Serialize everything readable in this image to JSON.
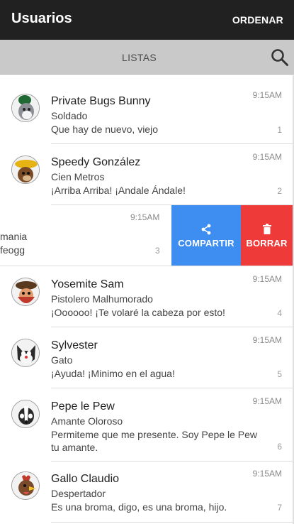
{
  "appbar": {
    "title": "Usuarios",
    "action": "ORDENAR"
  },
  "tabs": {
    "active": "LISTAS"
  },
  "items": [
    {
      "name": "Private Bugs Bunny",
      "subtitle": "Soldado",
      "message": "Que hay de nuevo, viejo",
      "time": "9:15AM",
      "index": "1",
      "avatar": "bugs-bunny-avatar"
    },
    {
      "name": "Speedy González",
      "subtitle": "Cien Metros",
      "message": "¡Arriba Arriba! ¡Andale Ándale!",
      "time": "9:15AM",
      "index": "2",
      "avatar": "speedy-gonzalez-avatar"
    },
    {
      "line1": "mania",
      "line2": "feogg",
      "time": "9:15AM",
      "index": "3"
    },
    {
      "name": "Yosemite Sam",
      "subtitle": "Pistolero Malhumorado",
      "message": "¡Oooooo! ¡Te volaré la cabeza por esto!",
      "time": "9:15AM",
      "index": "4",
      "avatar": "yosemite-sam-avatar"
    },
    {
      "name": "Sylvester",
      "subtitle": "Gato",
      "message": "¡Ayuda! ¡Minimo en el agua!",
      "time": "9:15AM",
      "index": "5",
      "avatar": "sylvester-avatar"
    },
    {
      "name": "Pepe le Pew",
      "subtitle": "Amante Oloroso",
      "message": "Permiteme que me presente. Soy Pepe le Pew tu amante.",
      "time": "9:15AM",
      "index": "6",
      "avatar": "pepe-le-pew-avatar"
    },
    {
      "name": "Gallo Claudio",
      "subtitle": "Despertador",
      "message": "Es una broma, digo, es una broma, hijo.",
      "time": "9:15AM",
      "index": "7",
      "avatar": "gallo-claudio-avatar"
    }
  ],
  "swipe_actions": {
    "share": "COMPARTIR",
    "delete": "BORRAR"
  },
  "colors": {
    "appbar": "#212121",
    "tabbar": "#c9c9c9",
    "share": "#3d8ef0",
    "delete": "#ef3a3a"
  }
}
